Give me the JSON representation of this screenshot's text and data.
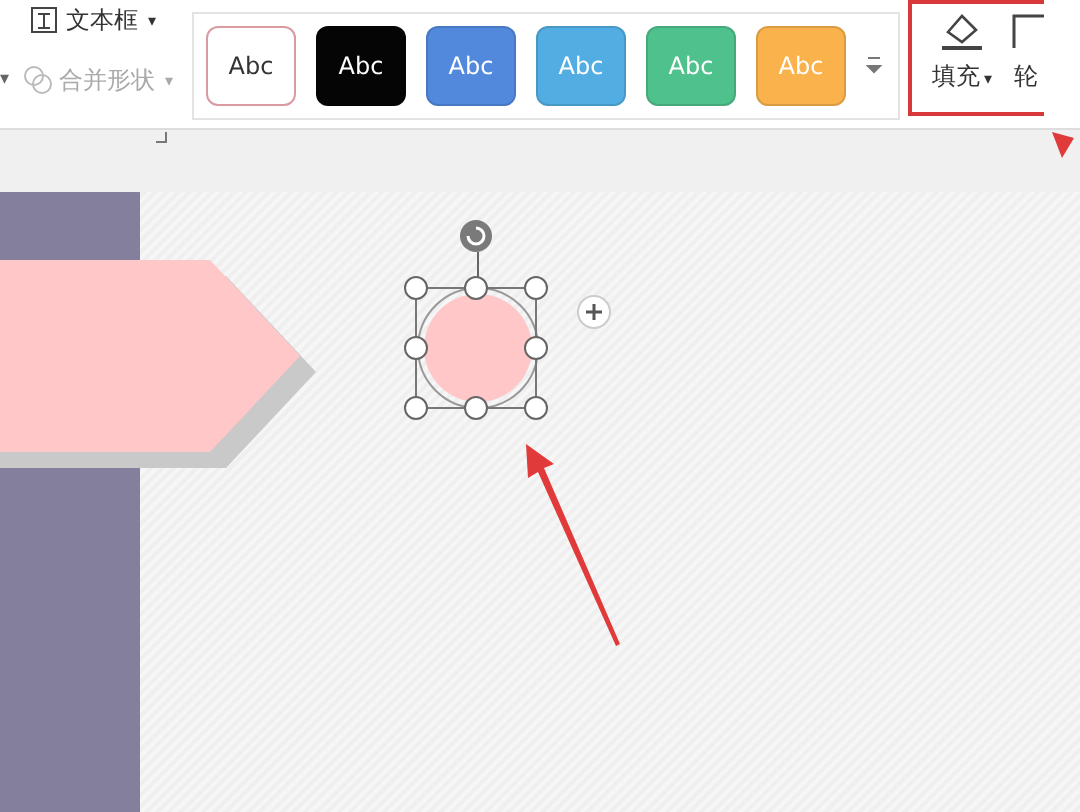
{
  "ribbon": {
    "cut_caret": "▾",
    "text_tools": [
      {
        "label": "文本框",
        "caret": "▾",
        "disabled": false
      },
      {
        "label": "合并形状",
        "caret": "▾",
        "disabled": true
      }
    ],
    "styles": [
      {
        "label": "Abc",
        "color": "#ffffff",
        "outlined": true
      },
      {
        "label": "Abc",
        "color": "#050505",
        "outlined": false
      },
      {
        "label": "Abc",
        "color": "#5289dc",
        "outlined": false
      },
      {
        "label": "Abc",
        "color": "#52aee2",
        "outlined": false
      },
      {
        "label": "Abc",
        "color": "#4fc18c",
        "outlined": false
      },
      {
        "label": "Abc",
        "color": "#f9b24c",
        "outlined": false
      }
    ],
    "fill": {
      "label": "填充",
      "caret": "▾"
    },
    "outline": {
      "label": "轮"
    },
    "highlighted": true
  },
  "slide": {
    "shape_selected": true
  }
}
